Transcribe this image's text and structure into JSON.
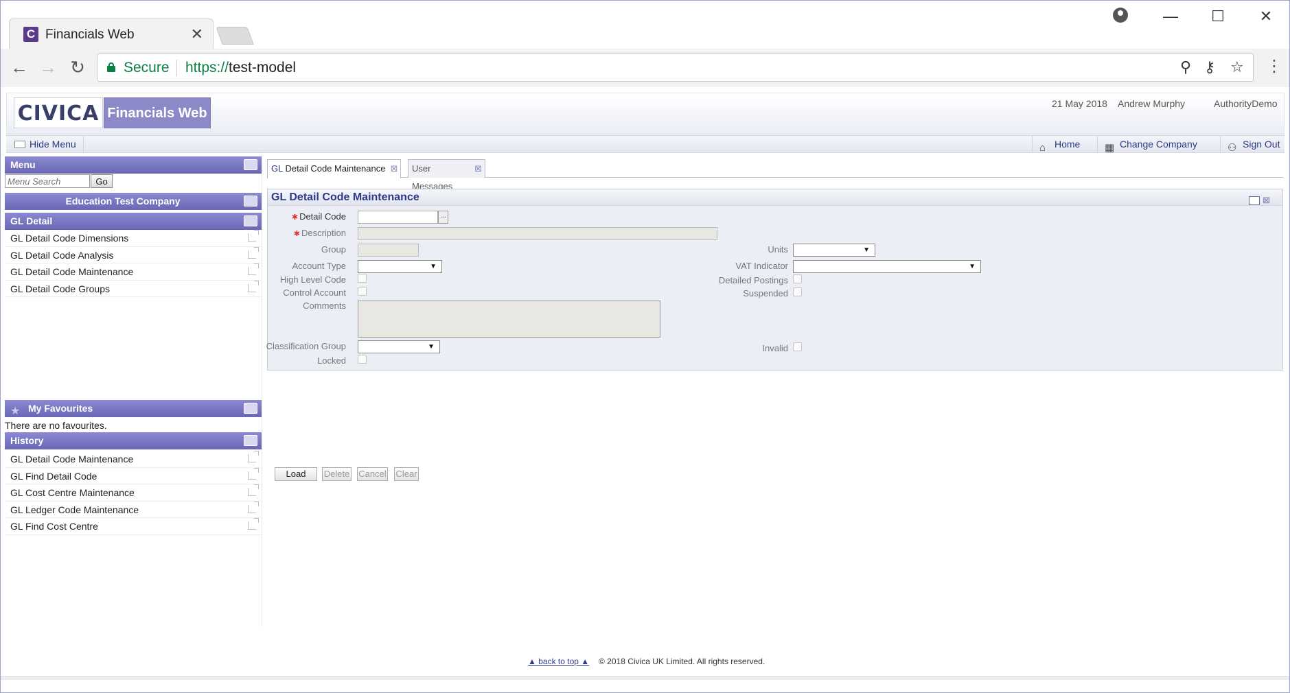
{
  "browser": {
    "tab_title": "Financials Web",
    "tab_favicon": "C",
    "secure_label": "Secure",
    "url_scheme": "https://",
    "url_host": "test-model"
  },
  "header": {
    "logo_text": "CIVICA",
    "product": "Financials Web",
    "date": "21 May 2018",
    "user": "Andrew Murphy",
    "authority": "AuthorityDemo"
  },
  "navbar": {
    "hide_menu": "Hide Menu",
    "home": "Home",
    "change_company": "Change Company",
    "sign_out": "Sign Out"
  },
  "menu": {
    "title": "Menu",
    "search_placeholder": "Menu Search",
    "go_label": "Go",
    "company": "Education Test Company",
    "section": "GL Detail",
    "items": [
      "GL Detail Code Dimensions",
      "GL Detail Code Analysis",
      "GL Detail Code Maintenance",
      "GL Detail Code Groups"
    ]
  },
  "favourites": {
    "title": "My Favourites",
    "empty_text": "There are no favourites."
  },
  "history": {
    "title": "History",
    "items": [
      "GL Detail Code Maintenance",
      "GL Find Detail Code",
      "GL Cost Centre Maintenance",
      "GL Ledger Code Maintenance",
      "GL Find Cost Centre"
    ]
  },
  "tabs": [
    {
      "prefix": "GL",
      "label": "Detail Code Maintenance"
    },
    {
      "label": "User Messages"
    }
  ],
  "form": {
    "title": "GL Detail Code Maintenance",
    "labels": {
      "detail_code": "Detail Code",
      "description": "Description",
      "group": "Group",
      "account_type": "Account Type",
      "high_level_code": "High Level Code",
      "control_account": "Control Account",
      "comments": "Comments",
      "classification_group": "Classification Group",
      "locked": "Locked",
      "units": "Units",
      "vat_indicator": "VAT Indicator",
      "detailed_postings": "Detailed Postings",
      "suspended": "Suspended",
      "invalid": "Invalid"
    },
    "lookup_label": "..."
  },
  "actions": {
    "load": "Load",
    "delete": "Delete",
    "cancel": "Cancel",
    "clear": "Clear"
  },
  "footer": {
    "back_to_top": "back to top",
    "copyright": "© 2018 Civica UK Limited. All rights reserved."
  },
  "colors": {
    "accent": "#6a67b5",
    "link": "#2e3a87",
    "secure": "#0b8043"
  }
}
